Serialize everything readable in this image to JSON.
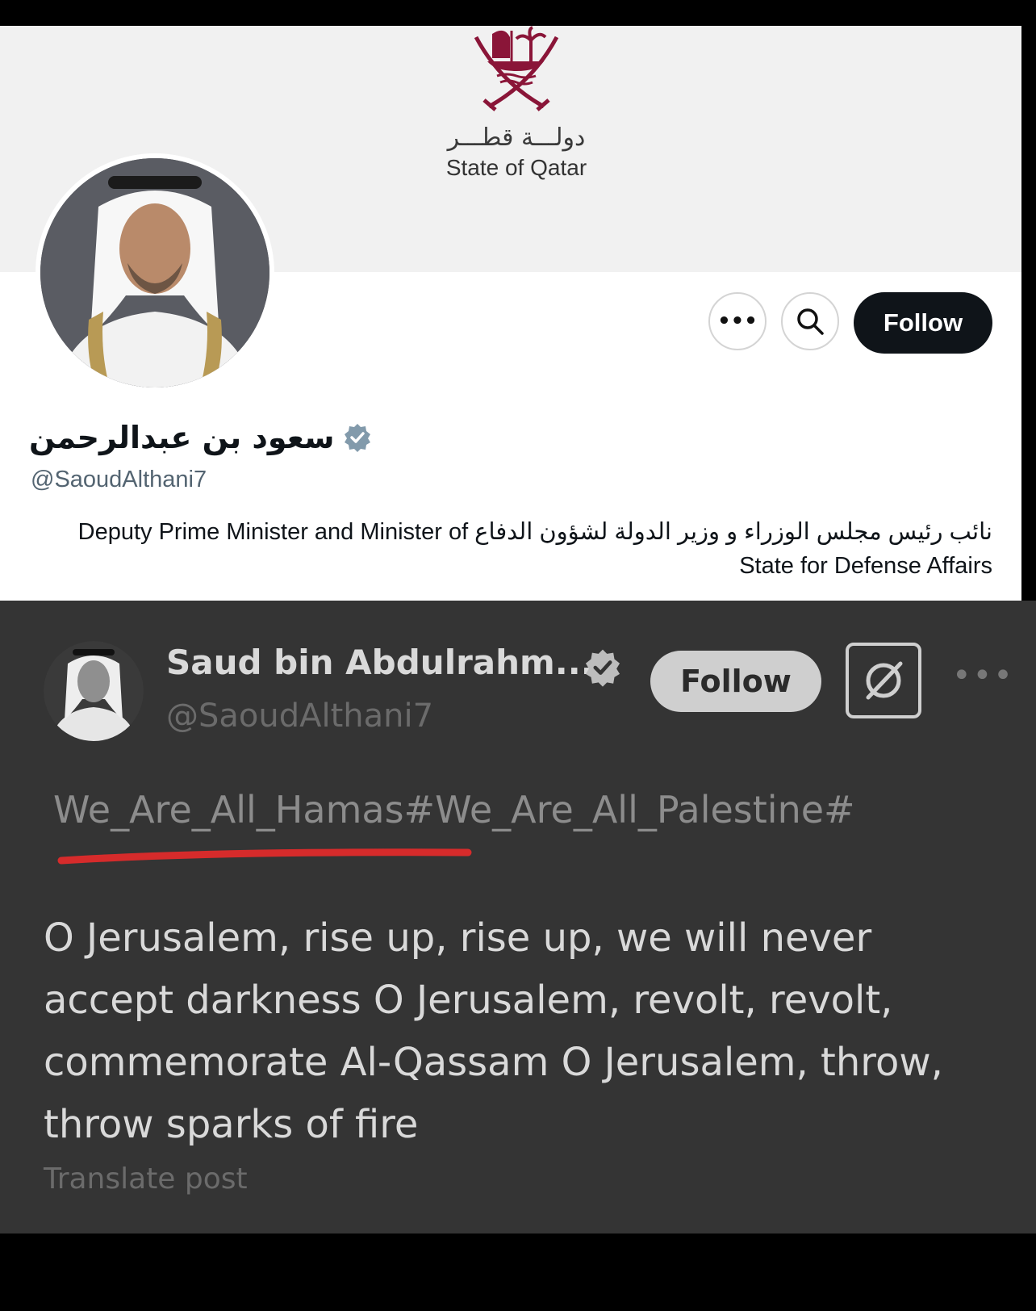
{
  "profile": {
    "banner": {
      "emblem_arabic": "دولـــة قطـــر",
      "emblem_english": "State of Qatar"
    },
    "actions": {
      "more_label": "•••",
      "follow_label": "Follow"
    },
    "display_name": "سعود بن عبدالرحمن",
    "handle": "@SaoudAlthani7",
    "bio": "نائب رئيس مجلس الوزراء و وزير الدولة لشؤون الدفاع Deputy Prime Minister and Minister of State for Defense Affairs"
  },
  "tweet": {
    "author_name": "Saud bin Abdulrahm...",
    "author_handle": "@SaoudAlthani7",
    "follow_label": "Follow",
    "more_label": "•••",
    "hashtags": "We_Are_All_Hamas#We_Are_All_Palestine#",
    "body": "O Jerusalem, rise up, rise up, we will never accept darkness O Jerusalem, revolt, revolt, commemorate Al-Qassam O Jerusalem, throw, throw sparks of fire",
    "translate_label": "Translate post"
  },
  "colors": {
    "verified_top": "#829aab",
    "underline": "#d62b2b",
    "emblem": "#8a1538"
  }
}
